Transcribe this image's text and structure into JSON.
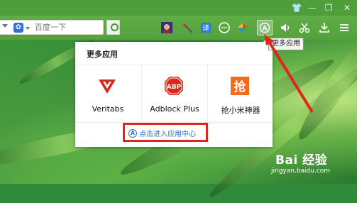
{
  "window": {
    "buttons": [
      "skin-icon",
      "minimize-icon",
      "restore-icon",
      "close-icon"
    ]
  },
  "search": {
    "placeholder": "百度一下",
    "engine_icon": "paw-icon"
  },
  "toolbar": {
    "icons": [
      "avatar-icon",
      "tool-icon",
      "translate-icon",
      "chat-icon",
      "color-icon",
      "app-center-icon",
      "volume-icon",
      "scissors-icon",
      "download-icon",
      "menu-icon"
    ]
  },
  "tooltip": {
    "text": "更多应用"
  },
  "popup": {
    "title": "更多应用",
    "apps": [
      {
        "label": "Veritabs",
        "icon": "veritabs-icon",
        "color": "#d42a1e"
      },
      {
        "label": "Adblock Plus",
        "icon": "abp-icon",
        "color": "#d9271c"
      },
      {
        "label": "抢小米神器",
        "icon": "grab-icon",
        "color": "#f26b1d"
      }
    ],
    "app_center_link": "点击进入应用中心"
  },
  "watermark": {
    "brand": "Bai 经验",
    "url": "jingyan.baidu.com"
  },
  "colors": {
    "toolbar": "#5aa743",
    "link": "#2a6fd6",
    "highlight": "#e2241c"
  }
}
